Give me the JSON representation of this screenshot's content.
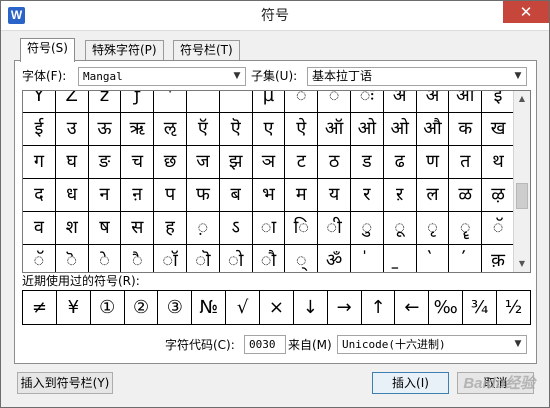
{
  "window": {
    "title": "符号",
    "app_icon": "W",
    "close_glyph": "✕"
  },
  "tabs": [
    {
      "label": "符号(S)"
    },
    {
      "label": "特殊字符(P)"
    },
    {
      "label": "符号栏(T)"
    }
  ],
  "font": {
    "label": "字体(F):",
    "value": "Mangal"
  },
  "subset": {
    "label": "子集(U):",
    "value": "基本拉丁语"
  },
  "symbol_grid": [
    [
      "Y",
      "Z",
      "ž",
      "ƒ",
      "ˈ",
      "ˆ",
      "˜",
      "µ",
      "◌ं",
      "◌ँ",
      "◌ः",
      "अं",
      "अ",
      "आ",
      "इ"
    ],
    [
      "ई",
      "उ",
      "ऊ",
      "ऋ",
      "ऌ",
      "ऍ",
      "ऎ",
      "ए",
      "ऐ",
      "ऑ",
      "ओ",
      "ओ",
      "औ",
      "क",
      "ख"
    ],
    [
      "ग",
      "घ",
      "ङ",
      "च",
      "छ",
      "ज",
      "झ",
      "ञ",
      "ट",
      "ठ",
      "ड",
      "ढ",
      "ण",
      "त",
      "थ"
    ],
    [
      "द",
      "ध",
      "न",
      "ऩ",
      "प",
      "फ",
      "ब",
      "भ",
      "म",
      "य",
      "र",
      "ऱ",
      "ल",
      "ळ",
      "ऴ"
    ],
    [
      "व",
      "श",
      "ष",
      "स",
      "ह",
      "◌़",
      "ऽ",
      "ा",
      "ि",
      "ी",
      "◌ु",
      "◌ू",
      "◌ृ",
      "◌ॄ",
      "◌ॅ"
    ],
    [
      "ॅ",
      "ॆ",
      "े",
      "ै",
      "ॉ",
      "ॊ",
      "ो",
      "ौ",
      "्",
      "ॐ",
      "॑",
      "॒",
      "॓",
      "॔",
      "क़"
    ]
  ],
  "recent": {
    "label": "近期使用过的符号(R):",
    "symbols": [
      "≠",
      "¥",
      "①",
      "②",
      "③",
      "№",
      "√",
      "×",
      "↓",
      "→",
      "↑",
      "←",
      "‰",
      "¾",
      "½"
    ]
  },
  "char_code": {
    "label": "字符代码(C):",
    "value": "0030"
  },
  "from": {
    "label": "来自(M)",
    "value": "Unicode(十六进制)"
  },
  "buttons": {
    "insert_to_bar": "插入到符号栏(Y)",
    "insert": "插入(I)",
    "cancel": "取消"
  },
  "scroll": {
    "position_fraction": 0.62
  },
  "watermark": "Baidu经验"
}
